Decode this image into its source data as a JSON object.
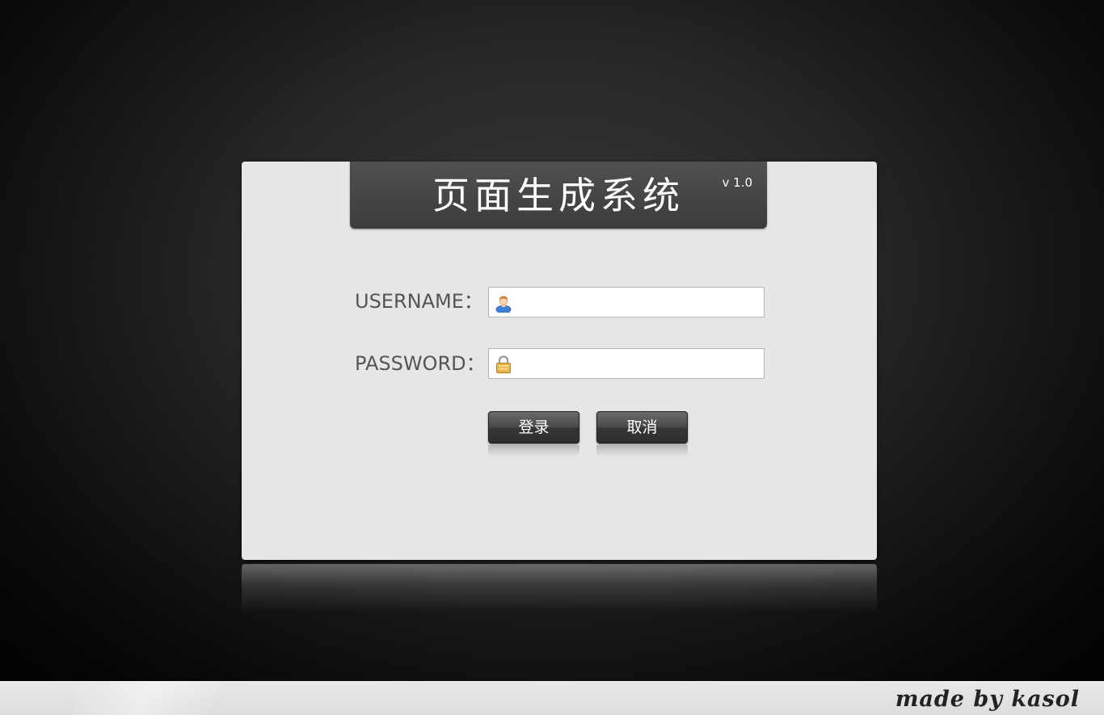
{
  "app": {
    "title": "页面生成系统",
    "version": "v 1.0"
  },
  "form": {
    "username_label": "USERNAME：",
    "password_label": "PASSWORD：",
    "username_value": "",
    "password_value": "",
    "username_icon": "user-icon",
    "password_icon": "lock-icon"
  },
  "buttons": {
    "login_label": "登录",
    "cancel_label": "取消"
  },
  "footer": {
    "credit": "made by kasol"
  },
  "colors": {
    "background": "#000000",
    "card": "#e6e6e6",
    "title_bar": "#444444",
    "button": "#3f3f3f",
    "footer": "#e4e4e4"
  }
}
